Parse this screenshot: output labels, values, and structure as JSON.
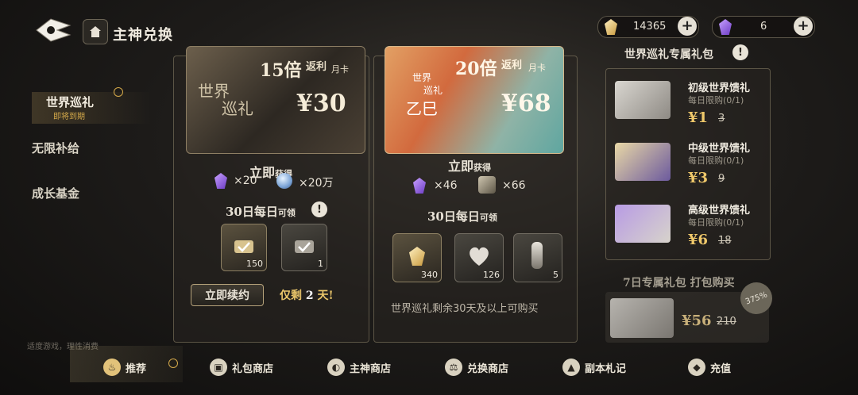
{
  "header": {
    "title": "主神兑换"
  },
  "resources": {
    "gold_amount": "14365",
    "crystal_amount": "6"
  },
  "sidebar": {
    "items": [
      {
        "label": "世界巡礼",
        "sub": "即将到期"
      },
      {
        "label": "无限补给"
      },
      {
        "label": "成长基金"
      }
    ]
  },
  "card1": {
    "multiplier": "15倍",
    "rebate": "返利",
    "monthcard": "月卡",
    "brand_line1": "世界",
    "brand_line2": "巡礼",
    "price": "¥30",
    "instant_title": "立即",
    "instant_suffix": "获得",
    "reward1": "×20",
    "reward2": "×20万",
    "daily_title": "30日每日",
    "daily_suffix": "可领",
    "daily1_count": "150",
    "daily2_count": "1",
    "renew_label": "立即续约",
    "remaining_prefix": "仅剩",
    "remaining_days": "2",
    "remaining_suffix": "天!"
  },
  "card2": {
    "multiplier": "20倍",
    "rebate": "返利",
    "monthcard": "月卡",
    "brand_line1": "世界",
    "brand_line2": "巡礼",
    "brand_line3": "乙巳",
    "price": "¥68",
    "instant_title": "立即",
    "instant_suffix": "获得",
    "reward1": "×46",
    "reward2": "×66",
    "daily_title": "30日每日",
    "daily_suffix": "可领",
    "daily1_count": "340",
    "daily2_count": "126",
    "daily3_count": "5",
    "note": "世界巡礼剩余30天及以上可购买"
  },
  "right_panel": {
    "title": "世界巡礼专属礼包",
    "gifts": [
      {
        "name": "初级世界馈礼",
        "limit": "每日限购(0/1)",
        "price": "¥1",
        "original": "3"
      },
      {
        "name": "中级世界馈礼",
        "limit": "每日限购(0/1)",
        "price": "¥3",
        "original": "9"
      },
      {
        "name": "高级世界馈礼",
        "limit": "每日限购(0/1)",
        "price": "¥6",
        "original": "18"
      }
    ],
    "bundle_title": "7日专属礼包 打包购买",
    "bundle_price": "¥56",
    "bundle_original": "210",
    "bundle_badge": "375%"
  },
  "footer": {
    "notice": "适度游戏，理性消费"
  },
  "tabbar": [
    {
      "label": "推荐",
      "icon": "flame-icon"
    },
    {
      "label": "礼包商店",
      "icon": "gift-icon"
    },
    {
      "label": "主神商店",
      "icon": "orb-icon"
    },
    {
      "label": "兑换商店",
      "icon": "scale-icon"
    },
    {
      "label": "副本札记",
      "icon": "triangle-icon"
    },
    {
      "label": "充值",
      "icon": "gem-icon"
    }
  ]
}
